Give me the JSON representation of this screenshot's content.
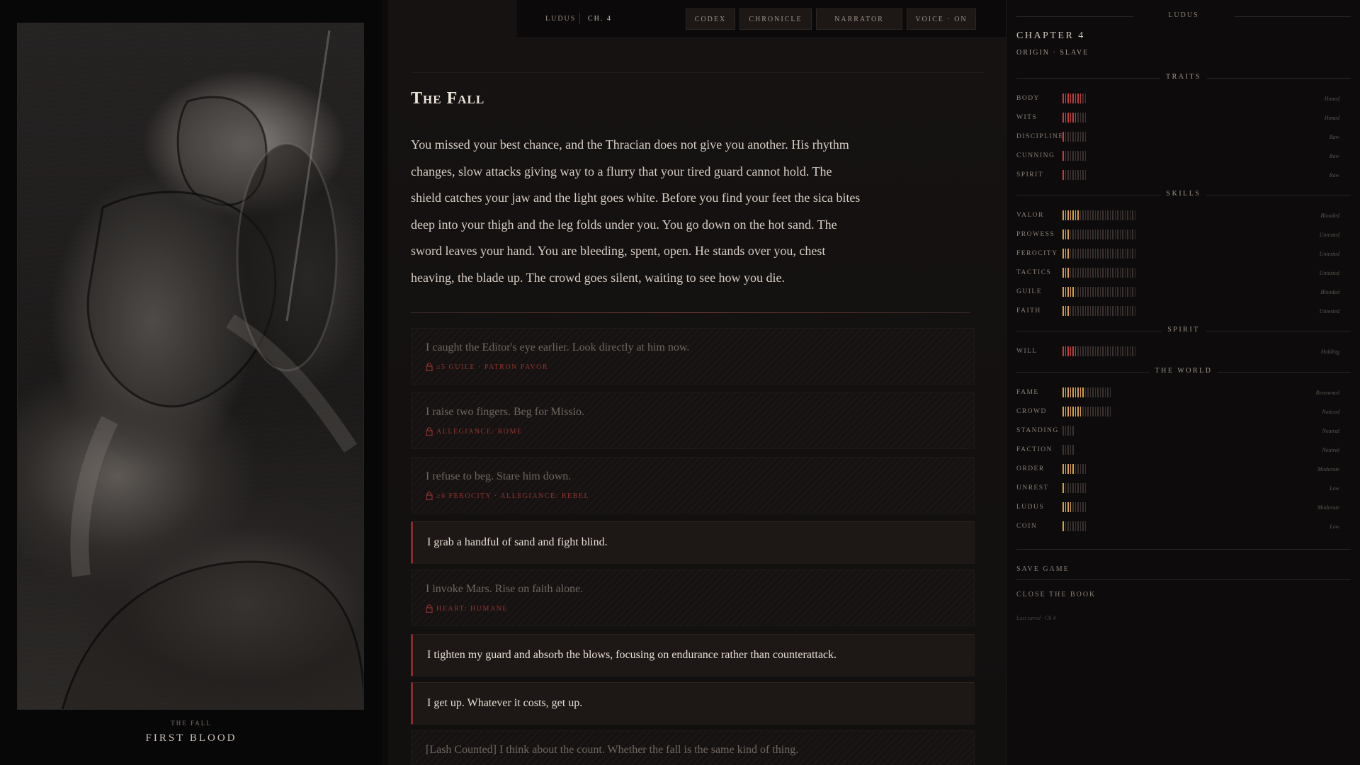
{
  "illustration": {
    "caption_small": "THE FALL",
    "caption_big": "FIRST BLOOD"
  },
  "topbar": {
    "brand": "LUDUS",
    "chapter": "CH. 4",
    "buttons": {
      "codex": "CODEX",
      "chronicle": "CHRONICLE",
      "narrator": "NARRATOR",
      "voice": "VOICE · ON"
    }
  },
  "scene": {
    "title": "The Fall",
    "text": "You missed your best chance, and the Thracian does not give you another. His rhythm changes, slow attacks giving way to a flurry that your tired guard cannot hold. The shield catches your jaw and the light goes white. Before you find your feet the sica bites deep into your thigh and the leg folds under you. You go down on the hot sand. The sword leaves your hand. You are bleeding, spent, open. He stands over you, chest heaving, the blade up. The crowd goes silent, waiting to see how you die."
  },
  "choices": [
    {
      "text": "I caught the Editor's eye earlier. Look directly at him now.",
      "req": "≥5 GUILE · PATRON FAVOR",
      "locked": true
    },
    {
      "text": "I raise two fingers. Beg for Missio.",
      "req": "ALLEGIANCE: ROME",
      "locked": true
    },
    {
      "text": "I refuse to beg. Stare him down.",
      "req": "≥6 FEROCITY · ALLEGIANCE: REBEL",
      "locked": true
    },
    {
      "text": "I grab a handful of sand and fight blind.",
      "req": "",
      "locked": false
    },
    {
      "text": "I invoke Mars. Rise on faith alone.",
      "req": "HEART: HUMANE",
      "locked": true
    },
    {
      "text": "I tighten my guard and absorb the blows, focusing on endurance rather than counterattack.",
      "req": "",
      "locked": false
    },
    {
      "text": "I get up. Whatever it costs, get up.",
      "req": "",
      "locked": false
    },
    {
      "text": "[Lash Counted] I think about the count. Whether the fall is the same kind of thing.",
      "req": "",
      "locked": true
    }
  ],
  "sidebar": {
    "brand": "LUDUS",
    "chapter": "CHAPTER 4",
    "origin": "ORIGIN · SLAVE",
    "sections": [
      {
        "title": "TRAITS",
        "color": "#c23b3b",
        "stats": [
          {
            "label": "BODY",
            "value": 8,
            "max": 10,
            "desc": "Honed"
          },
          {
            "label": "WITS",
            "value": 6,
            "max": 10,
            "desc": "Honed"
          },
          {
            "label": "DISCIPLINE",
            "value": 1,
            "max": 10,
            "desc": "Raw"
          },
          {
            "label": "CUNNING",
            "value": 1,
            "max": 10,
            "desc": "Raw"
          },
          {
            "label": "SPIRIT",
            "value": 1,
            "max": 10,
            "desc": "Raw"
          }
        ]
      },
      {
        "title": "SKILLS",
        "color": "#d6a13b",
        "stats": [
          {
            "label": "VALOR",
            "value": 7,
            "max": 30,
            "desc": "Blooded"
          },
          {
            "label": "PROWESS",
            "value": 3,
            "max": 30,
            "desc": "Untested"
          },
          {
            "label": "FEROCITY",
            "value": 3,
            "max": 30,
            "desc": "Untested"
          },
          {
            "label": "TACTICS",
            "value": 3,
            "max": 30,
            "desc": "Untested"
          },
          {
            "label": "GUILE",
            "value": 5,
            "max": 30,
            "desc": "Blooded"
          },
          {
            "label": "FAITH",
            "value": 3,
            "max": 30,
            "desc": "Untested"
          }
        ]
      },
      {
        "title": "SPIRIT",
        "color": "#c23b3b",
        "stats": [
          {
            "label": "WILL",
            "value": 6,
            "max": 30,
            "desc": "Holding"
          }
        ]
      },
      {
        "title": "THE WORLD",
        "color": "#d6a13b",
        "stats": [
          {
            "label": "FAME",
            "value": 9,
            "max": 20,
            "desc": "Renowned"
          },
          {
            "label": "CROWD",
            "value": 8,
            "max": 20,
            "desc": "Noticed"
          },
          {
            "label": "STANDING",
            "value": 0,
            "max": 5,
            "desc": "Neutral"
          },
          {
            "label": "FACTION",
            "value": 0,
            "max": 5,
            "desc": "Neutral"
          },
          {
            "label": "ORDER",
            "value": 5,
            "max": 10,
            "desc": "Moderate"
          },
          {
            "label": "UNREST",
            "value": 1,
            "max": 10,
            "desc": "Low"
          },
          {
            "label": "LUDUS",
            "value": 4,
            "max": 10,
            "desc": "Moderate"
          },
          {
            "label": "COIN",
            "value": 1,
            "max": 10,
            "desc": "Low"
          }
        ]
      }
    ],
    "save_label": "SAVE GAME",
    "close_label": "CLOSE THE BOOK",
    "saved_note": "Last saved · Ch 4"
  }
}
